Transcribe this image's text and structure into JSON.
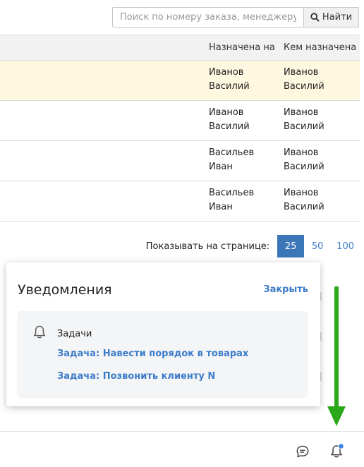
{
  "search": {
    "placeholder": "Поиск по номеру заказа, менеджеру,",
    "button_label": "Найти",
    "button_icon": "search-icon"
  },
  "table": {
    "columns": [
      "Назначена на",
      "Кем назначена"
    ],
    "rows": [
      {
        "assigned_to": "Иванов Василий",
        "assigned_by": "Иванов Василий",
        "highlighted": true
      },
      {
        "assigned_to": "Иванов Василий",
        "assigned_by": "Иванов Василий",
        "highlighted": false
      },
      {
        "assigned_to": "Васильев Иван",
        "assigned_by": "Иванов Василий",
        "highlighted": false
      },
      {
        "assigned_to": "Васильев Иван",
        "assigned_by": "Иванов Василий",
        "highlighted": false
      }
    ],
    "highlight_color": "#fff8e1"
  },
  "pagination": {
    "label": "Показывать на странице:",
    "options": [
      "25",
      "50",
      "100"
    ],
    "selected": "25",
    "accent": "#3a76b8"
  },
  "notifications": {
    "title": "Уведомления",
    "close_label": "Закрыть",
    "group_icon": "bell-icon",
    "group_title": "Задачи",
    "tasks": [
      "Задача: Навести порядок в товарах",
      "Задача: Позвонить клиенту N"
    ],
    "link_color": "#3d7cc9"
  },
  "annotation": {
    "arrow_color": "#2aa81a",
    "arrow_icon": "arrow-down-icon"
  },
  "bottom_bar": {
    "icons": [
      "chat-icon",
      "bell-icon"
    ],
    "badge_color": "#3a86e0"
  }
}
